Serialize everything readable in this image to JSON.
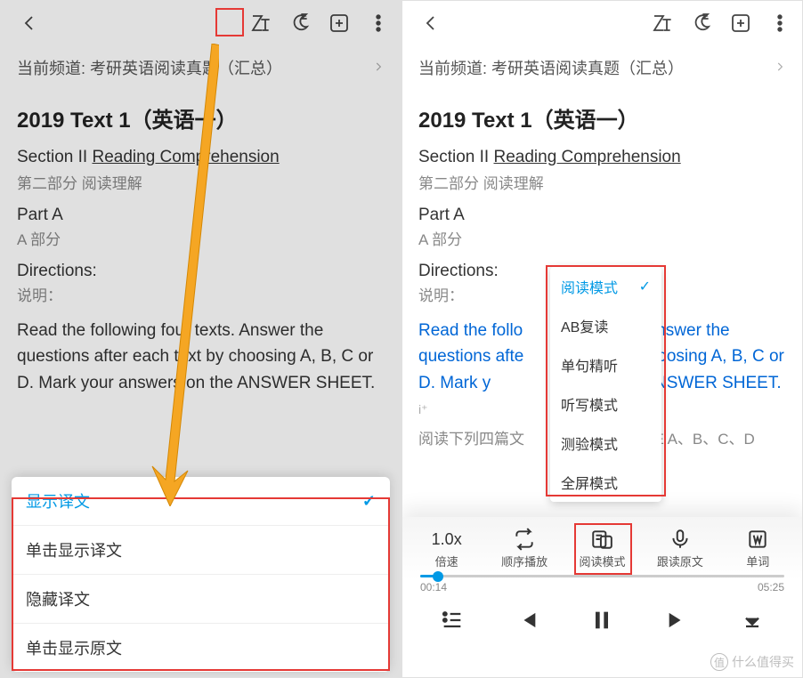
{
  "channel": {
    "prefix": "当前频道:",
    "name": "考研英语阅读真题（汇总）"
  },
  "title": "2019 Text 1（英语一）",
  "section": {
    "label": "Section II",
    "link": "Reading Comprehension",
    "sub": "第二部分 阅读理解"
  },
  "partA": {
    "label": "Part A",
    "sub": "A 部分"
  },
  "directions": {
    "label": "Directions:",
    "sub": "说明："
  },
  "bodyLeft": "Read the following four texts. Answer the questions after each text by choosing A, B, C or D. Mark your answers on the ANSWER SHEET.",
  "bodyRight": {
    "en1": "Read the follo",
    "en2": "Answer the",
    "en3": "questions afte",
    "en4": "hoosing A, B,",
    "en5": "C or D. Mark y",
    "en6": "the ANSWER",
    "en7": "SHEET."
  },
  "bodyRightCn": "阅读下列四篇文",
  "bodyRightCn2": "E  A、B、C、D",
  "translateMenu": [
    "显示译文",
    "单击显示译文",
    "隐藏译文",
    "单击显示原文"
  ],
  "modeMenu": [
    "阅读模式",
    "AB复读",
    "单句精听",
    "听写模式",
    "测验模式",
    "全屏模式"
  ],
  "player": {
    "speed": "1.0x",
    "speedLabel": "倍速",
    "order": "顺序播放",
    "mode": "阅读模式",
    "follow": "跟读原文",
    "word": "单词",
    "cur": "00:14",
    "dur": "05:25"
  },
  "watermark": {
    "symbol": "值",
    "text": "什么值得买"
  }
}
